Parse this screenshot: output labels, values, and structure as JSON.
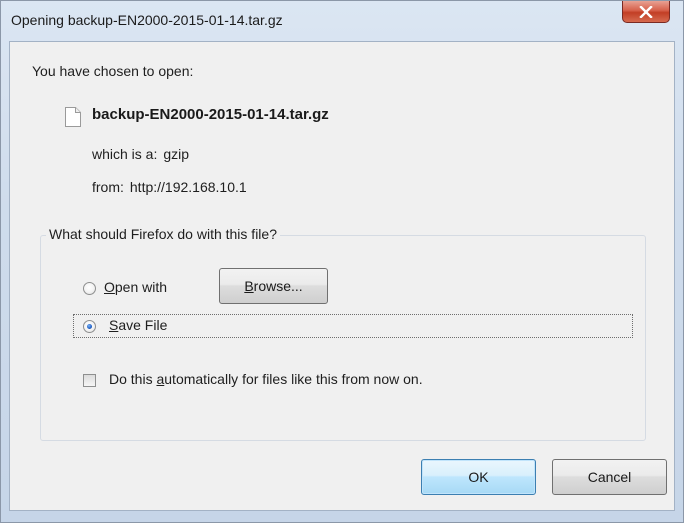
{
  "window": {
    "title": "Opening backup-EN2000-2015-01-14.tar.gz",
    "close_icon": "close-x-icon"
  },
  "intro": {
    "label": "You have chosen to open:"
  },
  "file": {
    "icon": "document-icon",
    "name": "backup-EN2000-2015-01-14.tar.gz",
    "type_label": "which is a:",
    "type_value": "gzip",
    "from_label": "from:",
    "from_value": "http://192.168.10.1"
  },
  "action_group": {
    "label": "What should Firefox do with this file?",
    "open_with": {
      "accesskey": "O",
      "rest": "pen with",
      "selected": false
    },
    "browse_button": {
      "accesskey": "B",
      "rest": "rowse..."
    },
    "save_file": {
      "accesskey": "S",
      "rest": "ave File",
      "selected": true
    },
    "auto_checkbox": {
      "before": "Do this ",
      "accesskey": "a",
      "after": "utomatically for files like this from now on.",
      "checked": false
    }
  },
  "buttons": {
    "ok": "OK",
    "cancel": "Cancel"
  },
  "colors": {
    "title_bar": "#cfdcec",
    "close_button": "#c94a30",
    "dialog_background": "#f0f0f0"
  }
}
